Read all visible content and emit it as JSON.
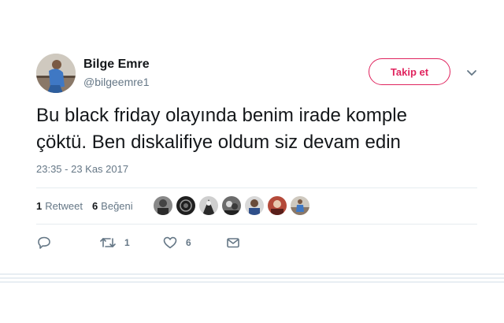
{
  "user": {
    "name": "Bilge Emre",
    "handle": "@bilgeemre1"
  },
  "follow_button": {
    "label": "Takip et"
  },
  "tweet": {
    "lines": [
      "Bu black friday olayında benim irade komple",
      "çöktü. Ben diskalifiye oldum siz devam edin"
    ],
    "timestamp": "23:35 - 23 Kas 2017"
  },
  "stats": {
    "retweets_count": "1",
    "retweets_label": "Retweet",
    "likes_count": "6",
    "likes_label": "Beğeni"
  },
  "actions": {
    "retweet_count": "1",
    "like_count": "6"
  },
  "icons": {
    "reply": "reply-icon",
    "retweet": "retweet-icon",
    "like": "heart-icon",
    "message": "envelope-icon",
    "more": "chevron-down-icon"
  },
  "colors": {
    "accent": "#e0245e",
    "muted": "#657786",
    "text": "#14171a"
  }
}
